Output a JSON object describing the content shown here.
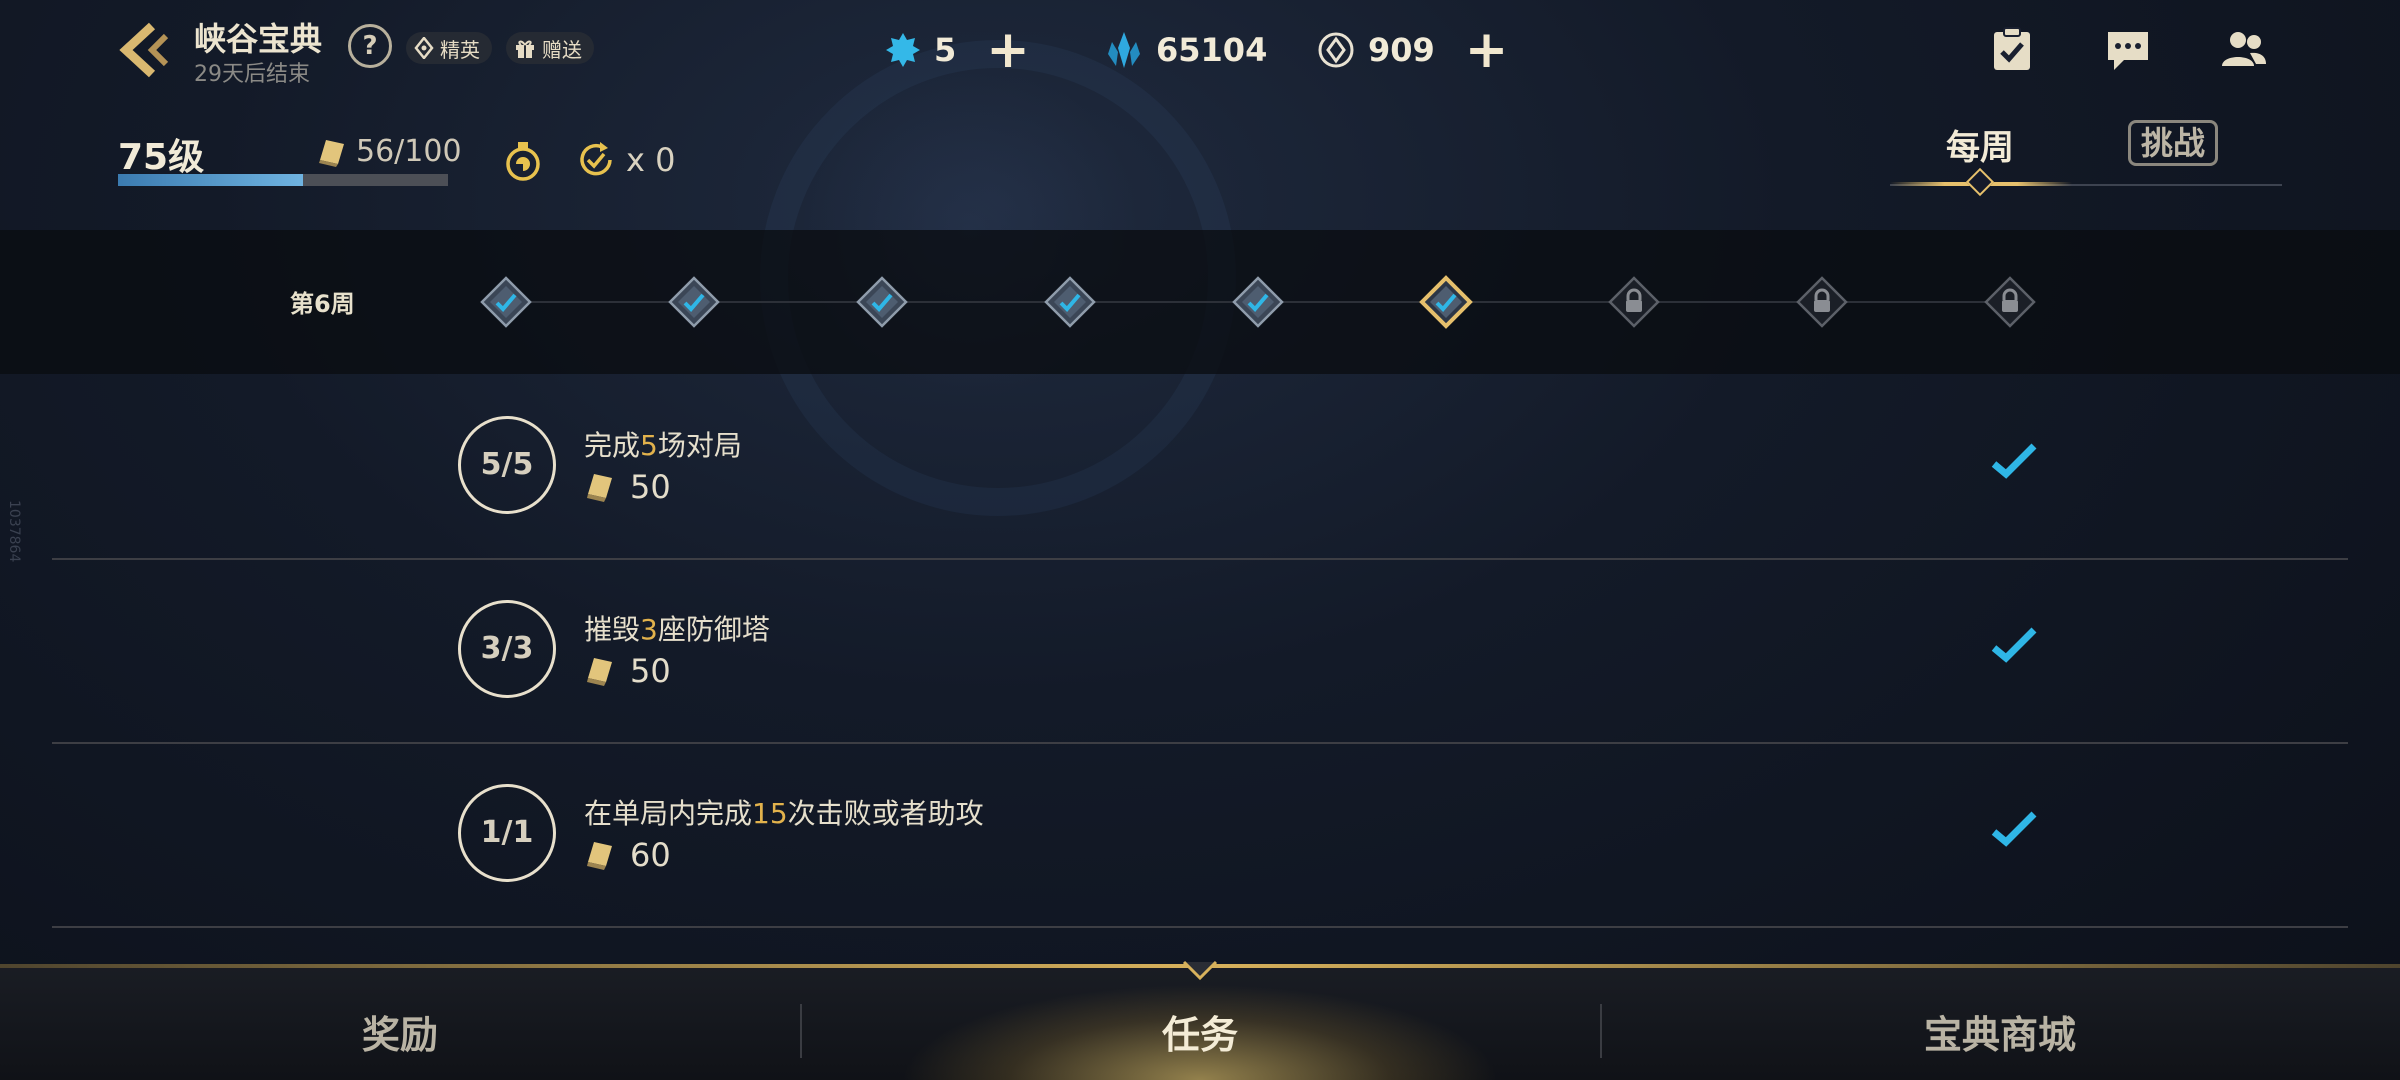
{
  "header": {
    "title": "峡谷宝典",
    "subtitle": "29天后结束",
    "help": "?",
    "tags": {
      "elite": "精英",
      "gift": "赠送"
    }
  },
  "currencies": [
    {
      "icon": "star-gem-icon",
      "value": "5",
      "has_plus": true
    },
    {
      "icon": "crystal-icon",
      "value": "65104",
      "has_plus": false
    },
    {
      "icon": "coupon-coin-icon",
      "value": "909",
      "has_plus": true
    }
  ],
  "top_icons": [
    "quest-clipboard-icon",
    "chat-icon",
    "friends-icon"
  ],
  "level": {
    "label": "75级",
    "xp_text": "56/100",
    "xp_fraction": 0.56,
    "refresh_count": "x 0"
  },
  "tabs": {
    "weekly": "每周",
    "challenge": "挑战",
    "active": "weekly"
  },
  "weeks": {
    "label": "第6周",
    "nodes": [
      {
        "state": "done"
      },
      {
        "state": "done"
      },
      {
        "state": "done"
      },
      {
        "state": "done"
      },
      {
        "state": "done"
      },
      {
        "state": "current-done"
      },
      {
        "state": "locked"
      },
      {
        "state": "locked"
      },
      {
        "state": "locked"
      }
    ]
  },
  "tasks": [
    {
      "progress": "5/5",
      "desc_pre": "完成",
      "desc_num": "5",
      "desc_post": "场对局",
      "reward": "50",
      "completed": true
    },
    {
      "progress": "3/3",
      "desc_pre": "摧毁",
      "desc_num": "3",
      "desc_post": "座防御塔",
      "reward": "50",
      "completed": true
    },
    {
      "progress": "1/1",
      "desc_pre": "在单局内完成",
      "desc_num": "15",
      "desc_post": "次击败或者助攻",
      "reward": "60",
      "completed": true
    }
  ],
  "bottom_nav": {
    "reward": "奖励",
    "tasks": "任务",
    "shop": "宝典商城",
    "active": "tasks"
  },
  "side_id": "1037864",
  "colors": {
    "accent_gold": "#e6c06c",
    "check_blue": "#2fb6e6",
    "highlight": "#e2b24c"
  }
}
